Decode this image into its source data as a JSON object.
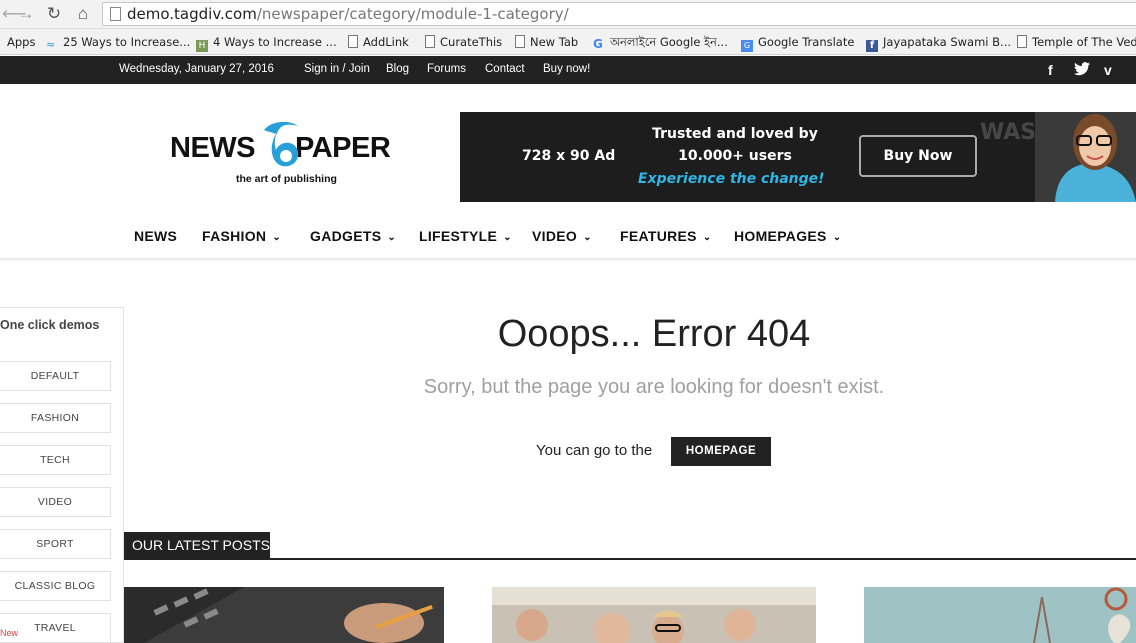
{
  "browser": {
    "url_host": "demo.tagdiv.com",
    "url_path": "/newspaper/category/module-1-category/",
    "bookmarks": [
      {
        "label": "Apps",
        "icon": "apps-icon"
      },
      {
        "label": "25 Ways to Increase...",
        "icon": "wave-icon"
      },
      {
        "label": "4 Ways to Increase ...",
        "icon": "h-icon"
      },
      {
        "label": "AddLink",
        "icon": "page-icon"
      },
      {
        "label": "CurateThis",
        "icon": "page-icon"
      },
      {
        "label": "New Tab",
        "icon": "page-icon"
      },
      {
        "label": "অনলাইনে Google ইন...",
        "icon": "google-icon"
      },
      {
        "label": "Google Translate",
        "icon": "translate-icon"
      },
      {
        "label": "Jayapataka Swami B...",
        "icon": "facebook-icon"
      },
      {
        "label": "Temple of The Vedi",
        "icon": "page-icon"
      }
    ]
  },
  "topbar": {
    "date": "Wednesday, January 27, 2016",
    "links": [
      "Sign in / Join",
      "Blog",
      "Forums",
      "Contact",
      "Buy now!"
    ]
  },
  "logo": {
    "left": "NEWS",
    "right": "PAPER",
    "tagline": "the art of publishing"
  },
  "ad": {
    "size": "728 x 90 Ad",
    "line1": "Trusted and loved by",
    "line2": "10.000+ users",
    "experience": "Experience the change!",
    "buy": "Buy Now",
    "bg_words": "WAS CAN BIG BOOK IS &",
    "brand_color": "#2fb6e6"
  },
  "nav": {
    "items": [
      {
        "label": "NEWS",
        "dropdown": false
      },
      {
        "label": "FASHION",
        "dropdown": true
      },
      {
        "label": "GADGETS",
        "dropdown": true
      },
      {
        "label": "LIFESTYLE",
        "dropdown": true
      },
      {
        "label": "VIDEO",
        "dropdown": true
      },
      {
        "label": "FEATURES",
        "dropdown": true
      },
      {
        "label": "HOMEPAGES",
        "dropdown": true
      }
    ]
  },
  "demos": {
    "title": "One click demos",
    "items": [
      "DEFAULT",
      "FASHION",
      "TECH",
      "VIDEO",
      "SPORT",
      "CLASSIC BLOG",
      "TRAVEL"
    ],
    "new_badge": "New"
  },
  "error": {
    "title": "Ooops... Error 404",
    "subtitle": "Sorry, but the page you are looking for doesn't exist.",
    "go_text": "You can go to the",
    "home_button": "HOMEPAGE"
  },
  "latest": {
    "label": "OUR LATEST POSTS"
  }
}
